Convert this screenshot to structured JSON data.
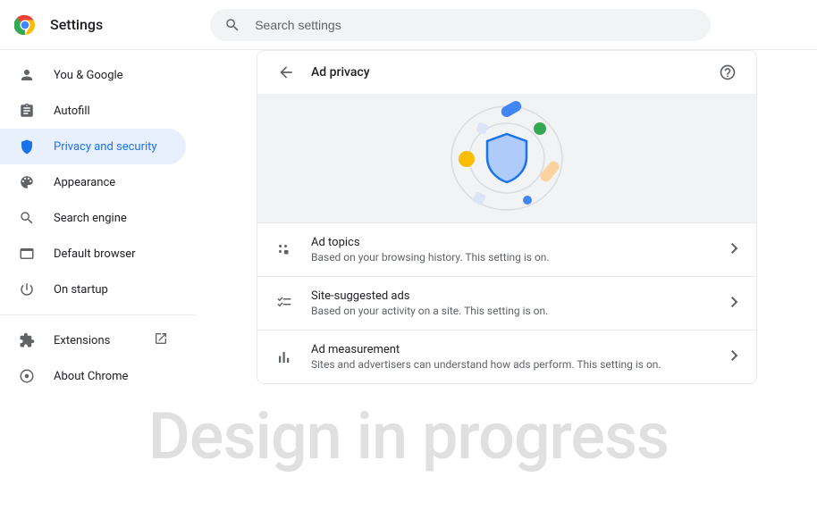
{
  "topbar": {
    "title": "Settings",
    "search_placeholder": "Search settings"
  },
  "sidebar": {
    "items": [
      {
        "label": "You & Google",
        "icon": "person"
      },
      {
        "label": "Autofill",
        "icon": "clipboard"
      },
      {
        "label": "Privacy and security",
        "icon": "shield",
        "active": true
      },
      {
        "label": "Appearance",
        "icon": "palette"
      },
      {
        "label": "Search engine",
        "icon": "search"
      },
      {
        "label": "Default browser",
        "icon": "browser"
      },
      {
        "label": "On startup",
        "icon": "power"
      }
    ],
    "footer_items": [
      {
        "label": "Extensions",
        "icon": "extension",
        "external": true
      },
      {
        "label": "About Chrome",
        "icon": "chrome"
      }
    ]
  },
  "panel": {
    "title": "Ad privacy",
    "rows": [
      {
        "title": "Ad topics",
        "subtitle": "Based on your browsing history. This setting is on.",
        "icon": "topics"
      },
      {
        "title": "Site-suggested ads",
        "subtitle": "Based on your activity on a site. This setting is on.",
        "icon": "checklist"
      },
      {
        "title": "Ad measurement",
        "subtitle": "Sites and advertisers can understand how ads perform. This setting is on.",
        "icon": "bars"
      }
    ]
  },
  "watermark": "Design in progress"
}
